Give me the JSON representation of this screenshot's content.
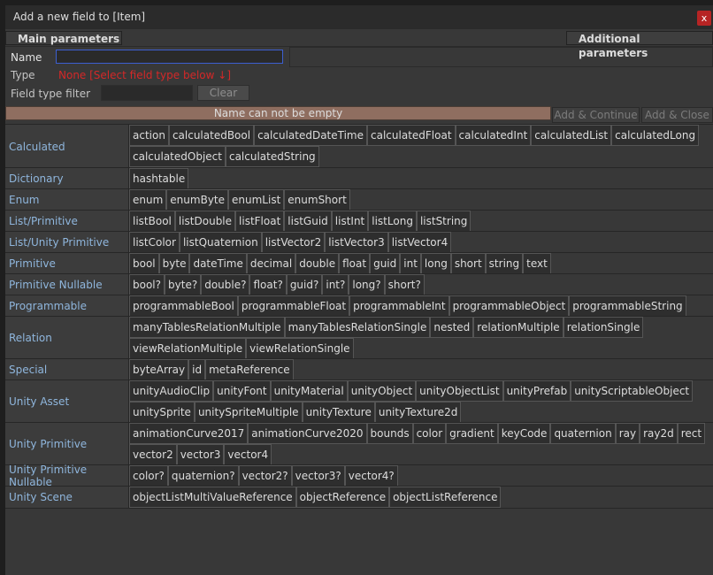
{
  "window": {
    "title": "Add a new field to [Item]",
    "close_label": "x"
  },
  "tabs": {
    "main": "Main parameters",
    "additional": "Additional parameters"
  },
  "form": {
    "name_label": "Name",
    "name_value": "",
    "type_label": "Type",
    "type_value": "None [Select field type below ↓]",
    "filter_label": "Field type filter",
    "filter_value": "",
    "clear_label": "Clear"
  },
  "error": "Name can not be empty",
  "actions": {
    "add_continue": "Add & Continue",
    "add_close": "Add & Close"
  },
  "colors": {
    "background": "#383838",
    "error_bar": "#8f6e60",
    "category_text": "#8fb6dd",
    "type_error_text": "#d42828",
    "close_button": "#b62424"
  },
  "categories": [
    {
      "name": "Calculated",
      "types": [
        "action",
        "calculatedBool",
        "calculatedDateTime",
        "calculatedFloat",
        "calculatedInt",
        "calculatedList",
        "calculatedLong",
        "calculatedObject",
        "calculatedString"
      ]
    },
    {
      "name": "Dictionary",
      "types": [
        "hashtable"
      ]
    },
    {
      "name": "Enum",
      "types": [
        "enum",
        "enumByte",
        "enumList",
        "enumShort"
      ]
    },
    {
      "name": "List/Primitive",
      "types": [
        "listBool",
        "listDouble",
        "listFloat",
        "listGuid",
        "listInt",
        "listLong",
        "listString"
      ]
    },
    {
      "name": "List/Unity Primitive",
      "types": [
        "listColor",
        "listQuaternion",
        "listVector2",
        "listVector3",
        "listVector4"
      ]
    },
    {
      "name": "Primitive",
      "types": [
        "bool",
        "byte",
        "dateTime",
        "decimal",
        "double",
        "float",
        "guid",
        "int",
        "long",
        "short",
        "string",
        "text"
      ]
    },
    {
      "name": "Primitive Nullable",
      "types": [
        "bool?",
        "byte?",
        "double?",
        "float?",
        "guid?",
        "int?",
        "long?",
        "short?"
      ]
    },
    {
      "name": "Programmable",
      "types": [
        "programmableBool",
        "programmableFloat",
        "programmableInt",
        "programmableObject",
        "programmableString"
      ]
    },
    {
      "name": "Relation",
      "types": [
        "manyTablesRelationMultiple",
        "manyTablesRelationSingle",
        "nested",
        "relationMultiple",
        "relationSingle",
        "viewRelationMultiple",
        "viewRelationSingle"
      ]
    },
    {
      "name": "Special",
      "types": [
        "byteArray",
        "id",
        "metaReference"
      ]
    },
    {
      "name": "Unity Asset",
      "types": [
        "unityAudioClip",
        "unityFont",
        "unityMaterial",
        "unityObject",
        "unityObjectList",
        "unityPrefab",
        "unityScriptableObject",
        "unitySprite",
        "unitySpriteMultiple",
        "unityTexture",
        "unityTexture2d"
      ]
    },
    {
      "name": "Unity Primitive",
      "types": [
        "animationCurve2017",
        "animationCurve2020",
        "bounds",
        "color",
        "gradient",
        "keyCode",
        "quaternion",
        "ray",
        "ray2d",
        "rect",
        "vector2",
        "vector3",
        "vector4"
      ]
    },
    {
      "name": "Unity Primitive Nullable",
      "types": [
        "color?",
        "quaternion?",
        "vector2?",
        "vector3?",
        "vector4?"
      ]
    },
    {
      "name": "Unity Scene",
      "types": [
        "objectListMultiValueReference",
        "objectReference",
        "objectListReference"
      ]
    }
  ]
}
